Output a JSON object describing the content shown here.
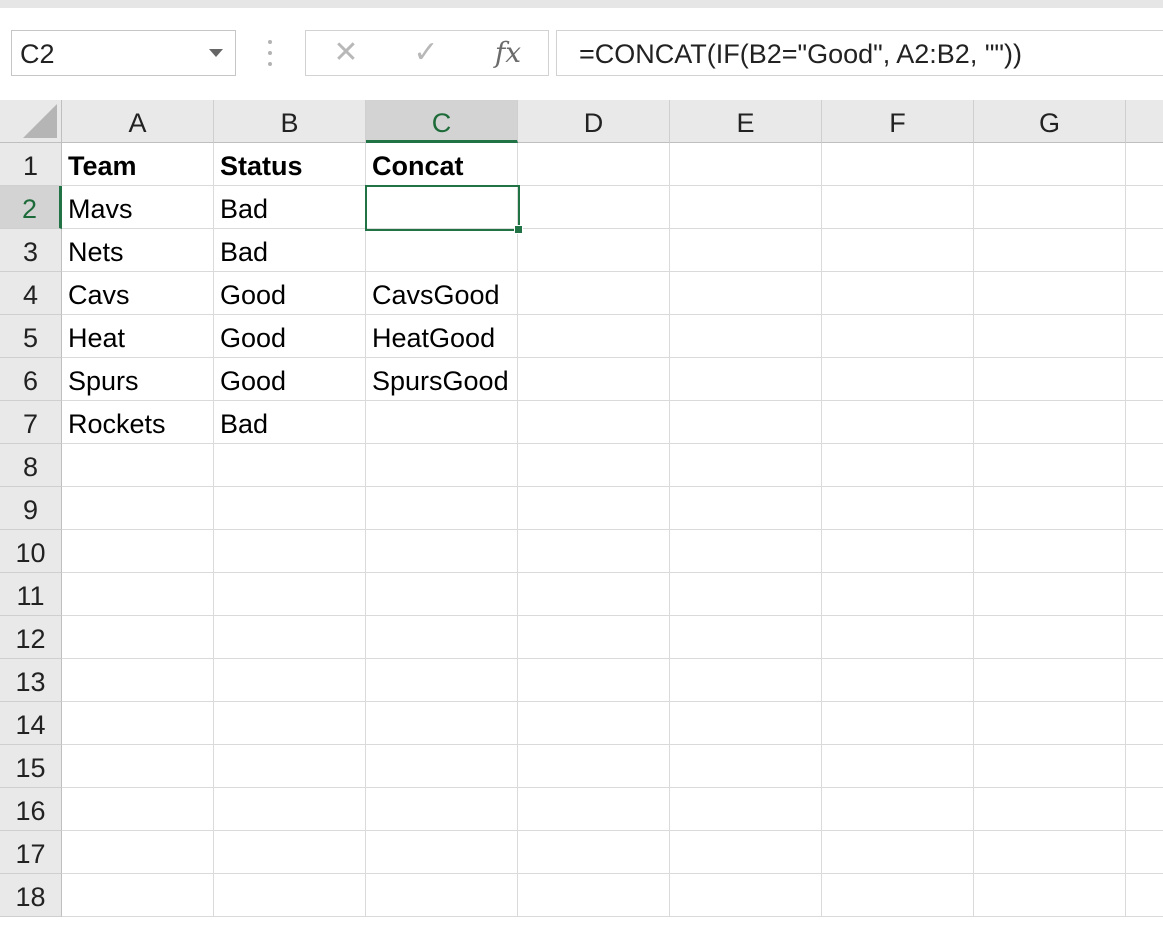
{
  "name_box": {
    "value": "C2"
  },
  "formula_bar": {
    "cancel_symbol": "✕",
    "enter_symbol": "✓",
    "fx_label": "fx",
    "formula": "=CONCAT(IF(B2=\"Good\", A2:B2, \"\"))"
  },
  "columns": [
    "A",
    "B",
    "C",
    "D",
    "E",
    "F",
    "G"
  ],
  "selected_column": "C",
  "rows": [
    "1",
    "2",
    "3",
    "4",
    "5",
    "6",
    "7",
    "8",
    "9",
    "10",
    "11",
    "12",
    "13",
    "14",
    "15",
    "16",
    "17",
    "18"
  ],
  "selected_row": "2",
  "cells": {
    "A1": "Team",
    "B1": "Status",
    "C1": "Concat",
    "A2": "Mavs",
    "B2": "Bad",
    "C2": "",
    "A3": "Nets",
    "B3": "Bad",
    "C3": "",
    "A4": "Cavs",
    "B4": "Good",
    "C4": "CavsGood",
    "A5": "Heat",
    "B5": "Good",
    "C5": "HeatGood",
    "A6": "Spurs",
    "B6": "Good",
    "C6": "SpursGood",
    "A7": "Rockets",
    "B7": "Bad",
    "C7": ""
  },
  "bold_row": "1",
  "active_cell": "C2",
  "colors": {
    "accent_green": "#217346",
    "header_bg": "#e9e9e9",
    "selected_header_bg": "#d3d3d3"
  }
}
